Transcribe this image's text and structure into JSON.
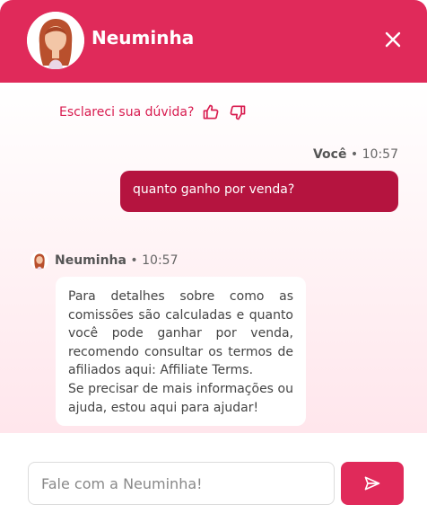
{
  "header": {
    "title": "Neuminha",
    "brand_color": "#e02a5a",
    "avatar_icon": "assistant-avatar",
    "close_icon": "close-icon"
  },
  "feedback": {
    "prompt": "Esclareci sua dúvida?",
    "thumb_up_icon": "thumbs-up-icon",
    "thumb_down_icon": "thumbs-down-icon"
  },
  "messages": [
    {
      "from": "user",
      "sender": "Você",
      "time": "10:57",
      "text": "quanto ganho por venda?",
      "bubble_color": "#b5143f"
    },
    {
      "from": "bot",
      "sender": "Neuminha",
      "time": "10:57",
      "text": "Para detalhes sobre como as comissões são calculadas e quanto você pode ganhar por venda, recomendo consultar os termos de afiliados aqui: Affiliate Terms.",
      "text2": "Se precisar de mais informações ou ajuda, estou aqui para ajudar!"
    }
  ],
  "composer": {
    "placeholder": "Fale com a Neuminha!",
    "send_icon": "send-icon"
  }
}
